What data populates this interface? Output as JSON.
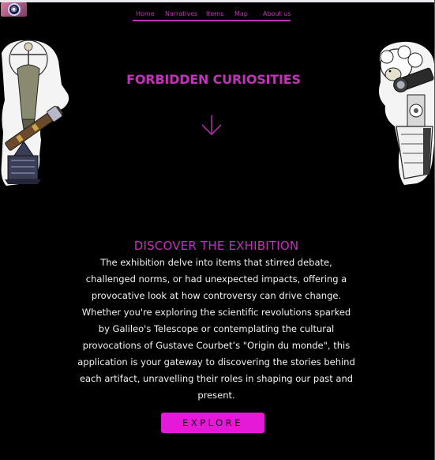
{
  "header": {
    "logo_icon": "camera-lens-icon",
    "nav": {
      "items": [
        {
          "label": "Home"
        },
        {
          "label": "Narratives"
        },
        {
          "label": "Items"
        },
        {
          "label": "Map"
        },
        {
          "label": "About us"
        }
      ]
    }
  },
  "hero": {
    "title": "FORBIDDEN CURIOSITIES",
    "arrow_icon": "arrow-down-icon",
    "left_art_icon": "vitruvian-telescope-collage",
    "right_art_icon": "sheep-telescope-collage"
  },
  "exhibition": {
    "title": "DISCOVER THE EXHIBITION",
    "text": "The exhibition delve into items that stirred debate, challenged norms, or had unexpected impacts, offering a provocative look at how controversy can drive change. Whether you're exploring the scientific revolutions sparked by Galileo's Telescope or contemplating the cultural provocations of Gustave Courbet’s \"Origin du monde\", this application is your gateway to discovering the stories behind each artifact, unravelling their roles in shaping our past and present.",
    "button_label": "EXPLORE"
  },
  "colors": {
    "background": "#000000",
    "accent": "#c232b8",
    "button": "#e51ad8",
    "text": "#f2f2f2"
  }
}
